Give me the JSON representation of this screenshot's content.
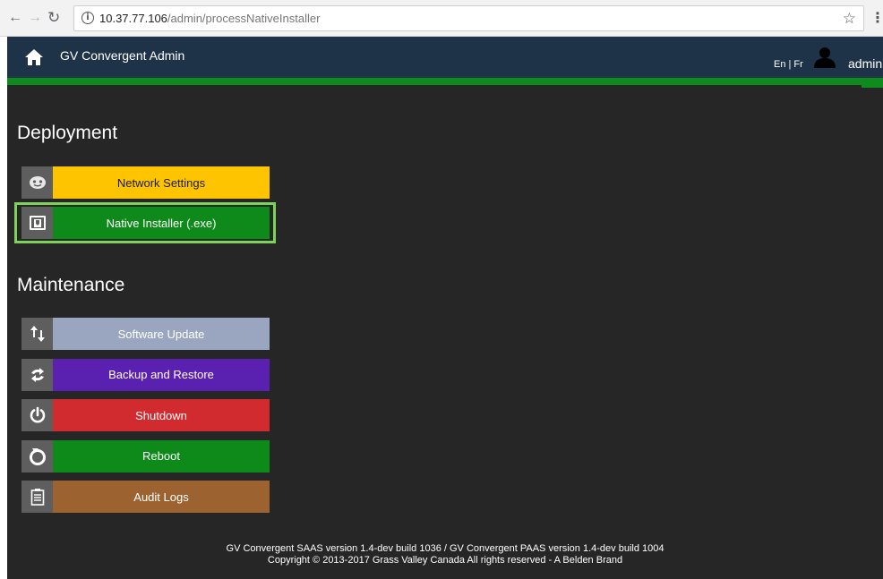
{
  "browser": {
    "url_host": "10.37.77.106",
    "url_path": "/admin/processNativeInstaller"
  },
  "header": {
    "title": "GV Convergent Admin",
    "lang": "En | Fr",
    "username": "admin"
  },
  "deployment": {
    "title": "Deployment",
    "items": [
      {
        "label": "Network Settings",
        "color": "#ffc400",
        "text_color": "#1a1a1a",
        "icon": "network-settings-icon"
      },
      {
        "label": "Native Installer (.exe)",
        "color": "#0e8a1a",
        "text_color": "#ffffff",
        "icon": "native-installer-icon",
        "selected": true
      }
    ]
  },
  "maintenance": {
    "title": "Maintenance",
    "items": [
      {
        "label": "Software Update",
        "color": "#9aa6bf",
        "text_color": "#ffffff",
        "icon": "software-update-icon"
      },
      {
        "label": "Backup and Restore",
        "color": "#5a20b0",
        "text_color": "#ffffff",
        "icon": "backup-restore-icon"
      },
      {
        "label": "Shutdown",
        "color": "#d12a2f",
        "text_color": "#ffffff",
        "icon": "power-icon"
      },
      {
        "label": "Reboot",
        "color": "#0e8a1a",
        "text_color": "#ffffff",
        "icon": "reboot-icon"
      },
      {
        "label": "Audit Logs",
        "color": "#9c6230",
        "text_color": "#ffffff",
        "icon": "audit-logs-icon"
      }
    ]
  },
  "footer": {
    "line1": "GV Convergent SAAS version 1.4-dev build 1036 / GV Convergent PAAS version 1.4-dev build 1004",
    "line2": "Copyright © 2013-2017 Grass Valley Canada All rights reserved - A Belden Brand"
  }
}
